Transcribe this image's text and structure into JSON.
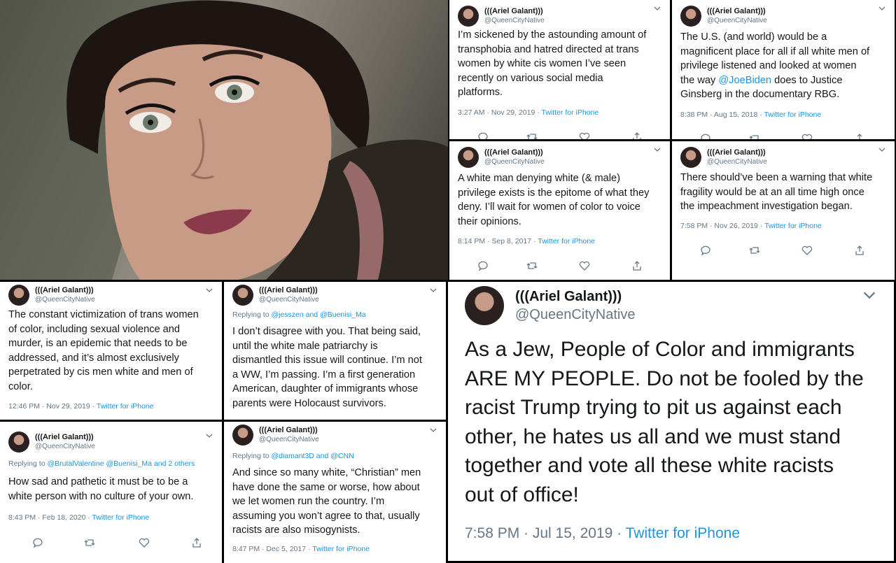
{
  "author": {
    "name": "(((Ariel Galant)))",
    "handle": "@QueenCityNative"
  },
  "photo": {
    "icon": "selfie-photo"
  },
  "separator": "·",
  "tweets": [
    {
      "id": "t1",
      "text": "I’m sickened by the astounding amount of\ntransphobia and hatred directed at trans\nwomen by white cis women I’ve seen\nrecently on various social media\nplatforms.",
      "time": "3:27 AM · Nov 29, 2019",
      "source": "Twitter for iPhone"
    },
    {
      "id": "t2",
      "text_before": "The U.S. (and world) would be a\nmagnificent place for all if all white men of\nprivilege listened and looked at women\nthe way ",
      "mention": "@JoeBiden",
      "text_after": " does to Justice\nGinsberg in the documentary RBG.",
      "time": "8:38 PM · Aug 15, 2018",
      "source": "Twitter for iPhone"
    },
    {
      "id": "t3",
      "text": "A white man denying white (& male)\nprivilege exists is the epitome of what they\ndeny. I’ll wait for women of color to voice\ntheir opinions.",
      "time": "8:14 PM · Sep 8, 2017",
      "source": "Twitter for iPhone"
    },
    {
      "id": "t4",
      "text": "There should’ve been a warning that white\nfragility would be at an all time high once\nthe impeachment investigation began.",
      "time": "7:58 PM · Nov 26, 2019",
      "source": "Twitter for iPhone"
    },
    {
      "id": "t5",
      "text": "The constant victimization of trans women\nof color, including sexual violence and\nmurder, is an epidemic that needs to be\naddressed, and it’s almost exclusively\nperpetrated by cis men white and men of\ncolor.",
      "time": "12:46 PM · Nov 29, 2019",
      "source": "Twitter for iPhone"
    },
    {
      "id": "t6",
      "replying_prefix": "Replying to ",
      "replying_to": "@jesszen and @Buenisi_Ma",
      "text": "I don’t disagree with you. That being said,\nuntil the white male patriarchy is\ndismantled this issue will continue. I’m not\na WW, I’m passing. I’m a first generation\nAmerican, daughter of immigrants whose\nparents were Holocaust survivors."
    },
    {
      "id": "t7",
      "replying_prefix": "Replying to ",
      "replying_to": "@BrutalValentine @Buenisi_Ma and 2 others",
      "text": "How sad and pathetic it must be to be a\nwhite person with no culture of your own.",
      "time": "8:43 PM · Feb 18, 2020",
      "source": "Twitter for iPhone"
    },
    {
      "id": "t8",
      "replying_prefix": "Replying to ",
      "replying_to": "@diamant3D and @CNN",
      "text": "And since so many white, “Christian” men\nhave done the same or worse, how about\nwe let women run the country. I’m\nassuming you won’t agree to that, usually\nracists are also misogynists.",
      "time": "8:47 PM · Dec 5, 2017",
      "source": "Twitter for iPhone"
    },
    {
      "id": "t9",
      "text": "As a Jew, People of Color and immigrants\nARE MY PEOPLE. Do not be fooled by the\nracist Trump trying to pit us against each\nother, he hates us all and we must stand\ntogether and vote all these white racists\nout of office!",
      "time": "7:58 PM · Jul 15, 2019",
      "source": "Twitter for iPhone"
    }
  ],
  "actions": [
    "reply-icon",
    "retweet-icon",
    "like-icon",
    "share-icon"
  ]
}
